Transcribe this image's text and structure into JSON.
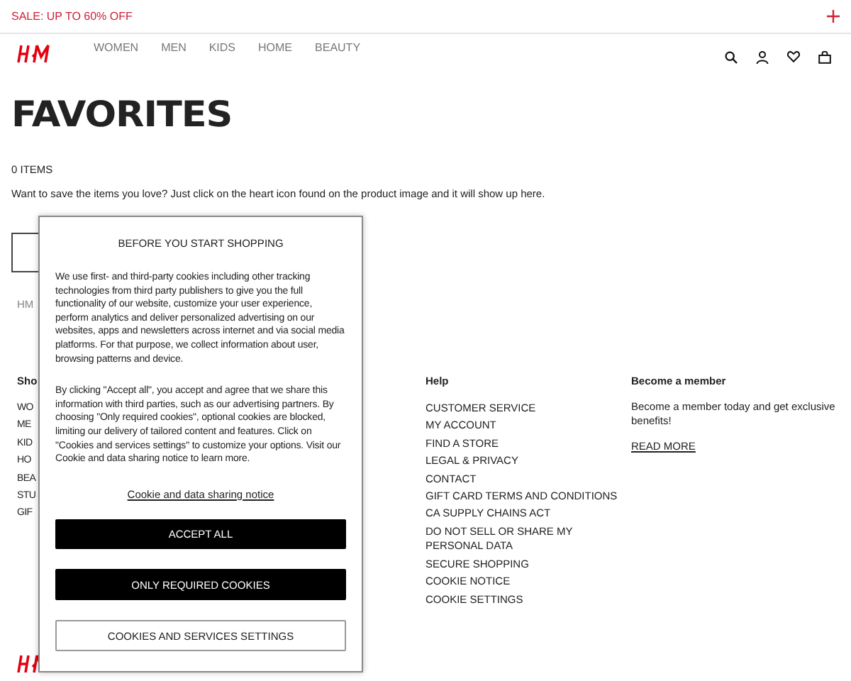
{
  "promo": {
    "text": "SALE: UP TO 60% OFF"
  },
  "nav": {
    "items": [
      "WOMEN",
      "MEN",
      "KIDS",
      "HOME",
      "BEAUTY"
    ]
  },
  "page": {
    "title": "FAVORITES",
    "count": "0 ITEMS",
    "description": "Want to save the items you love? Just click on the heart icon found on the product image and it will show up here.",
    "breadcrumb": "HM"
  },
  "footer": {
    "shop": {
      "heading": "Sho",
      "links": [
        "WO",
        "ME",
        "KID",
        "HO",
        "BEA",
        "STU",
        "GIF"
      ]
    },
    "help": {
      "heading": "Help",
      "links": [
        "CUSTOMER SERVICE",
        "MY ACCOUNT",
        "FIND A STORE",
        "LEGAL & PRIVACY",
        "CONTACT",
        "GIFT CARD TERMS AND CONDITIONS",
        "CA SUPPLY CHAINS ACT",
        "DO NOT SELL OR SHARE MY PERSONAL DATA",
        "SECURE SHOPPING",
        "COOKIE NOTICE",
        "COOKIE SETTINGS"
      ]
    },
    "member": {
      "heading": "Become a member",
      "text": "Become a member today and get exclusive benefits!",
      "link": "READ MORE"
    }
  },
  "cookie_dialog": {
    "title": "BEFORE YOU START SHOPPING",
    "paragraphs": [
      "We use first- and third-party cookies including other tracking technologies from third party publishers to give you the full functionality of our website, customize your user experience, perform analytics and deliver personalized advertising on our websites, apps and newsletters across internet and via social media platforms. For that purpose, we collect information about user, browsing patterns and device.",
      "By clicking \"Accept all\", you accept and agree that we share this information with third parties, such as our advertising partners. By choosing \"Only required cookies\", optional cookies are blocked, limiting our delivery of tailored content and features. Click on \"Cookies and services settings\" to customize your options. Visit our Cookie and data sharing notice to learn more."
    ],
    "notice_link": "Cookie and data sharing notice",
    "buttons": [
      {
        "label": "ACCEPT ALL",
        "kind": "primary"
      },
      {
        "label": "ONLY REQUIRED COOKIES",
        "kind": "primary"
      },
      {
        "label": "COOKIES AND SERVICES SETTINGS",
        "kind": "outline"
      }
    ]
  }
}
